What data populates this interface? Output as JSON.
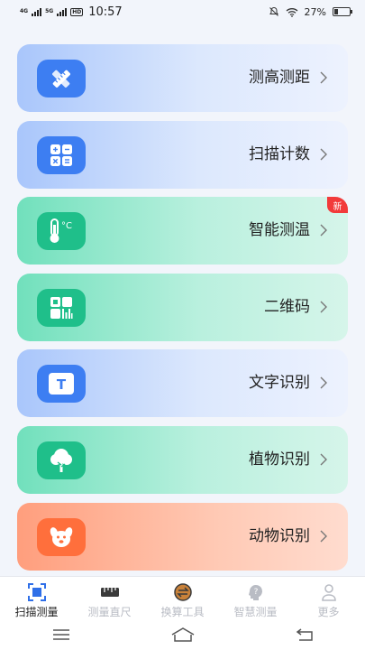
{
  "status": {
    "network1": "4G",
    "network2": "5G",
    "hd": "HD",
    "time": "10:57",
    "battery": "27%",
    "battery_level": 0.27
  },
  "cards": [
    {
      "label": "测高测距",
      "icon": "ruler-pencil-icon",
      "theme": "blue"
    },
    {
      "label": "扫描计数",
      "icon": "calculator-icon",
      "theme": "blue"
    },
    {
      "label": "智能测温",
      "icon": "thermometer-icon",
      "theme": "green",
      "badge": "新",
      "icon_text": "°C"
    },
    {
      "label": "二维码",
      "icon": "qr-code-icon",
      "theme": "green"
    },
    {
      "label": "文字识别",
      "icon": "text-recognition-icon",
      "theme": "blue",
      "icon_text": "T"
    },
    {
      "label": "植物识别",
      "icon": "tree-icon",
      "theme": "green"
    },
    {
      "label": "动物识别",
      "icon": "dog-icon",
      "theme": "orange"
    }
  ],
  "tabs": [
    {
      "label": "扫描测量",
      "icon": "scan-icon",
      "active": true
    },
    {
      "label": "测量直尺",
      "icon": "ruler-icon",
      "active": false
    },
    {
      "label": "换算工具",
      "icon": "convert-icon",
      "active": false
    },
    {
      "label": "智慧测量",
      "icon": "smart-measure-icon",
      "active": false
    },
    {
      "label": "更多",
      "icon": "user-icon",
      "active": false
    }
  ],
  "nav": [
    "menu-icon",
    "home-icon",
    "back-icon"
  ],
  "colors": {
    "blue_accent": "#3d7ef2",
    "green_accent": "#1fbf8a",
    "orange_accent": "#ff6f3c",
    "badge": "#f23a3a"
  }
}
